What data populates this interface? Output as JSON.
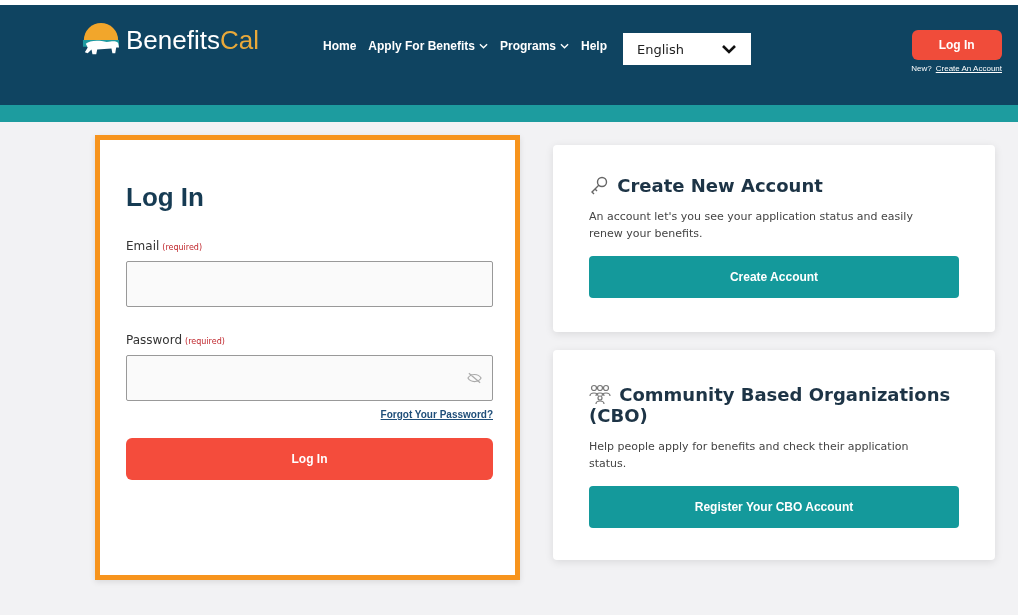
{
  "header": {
    "logo": {
      "name": "Benefits",
      "accent": "Cal"
    },
    "nav": [
      {
        "label": "Home",
        "dropdown": false
      },
      {
        "label": "Apply For Benefits",
        "dropdown": true
      },
      {
        "label": "Programs",
        "dropdown": true
      },
      {
        "label": "Help",
        "dropdown": false
      }
    ],
    "language": {
      "value": "English"
    },
    "login_button": "Log In",
    "new_prompt": "New?",
    "create_link": "Create An Account"
  },
  "login": {
    "highlighted": true,
    "title": "Log In",
    "fields": [
      {
        "label": "Email",
        "required": "(required)",
        "kind": "text"
      },
      {
        "label": "Password",
        "required": "(required)",
        "kind": "password"
      }
    ],
    "forgot": "Forgot Your Password?",
    "button": "Log In"
  },
  "cards": [
    {
      "kind": "key",
      "title": "Create New Account",
      "text": "An account let's you see your application status and easily renew your benefits.",
      "button": "Create Account"
    },
    {
      "kind": "people",
      "title": "Community Based Organizations (CBO)",
      "text": "Help people apply for benefits and check their application status.",
      "button": "Register Your CBO Account"
    }
  ]
}
